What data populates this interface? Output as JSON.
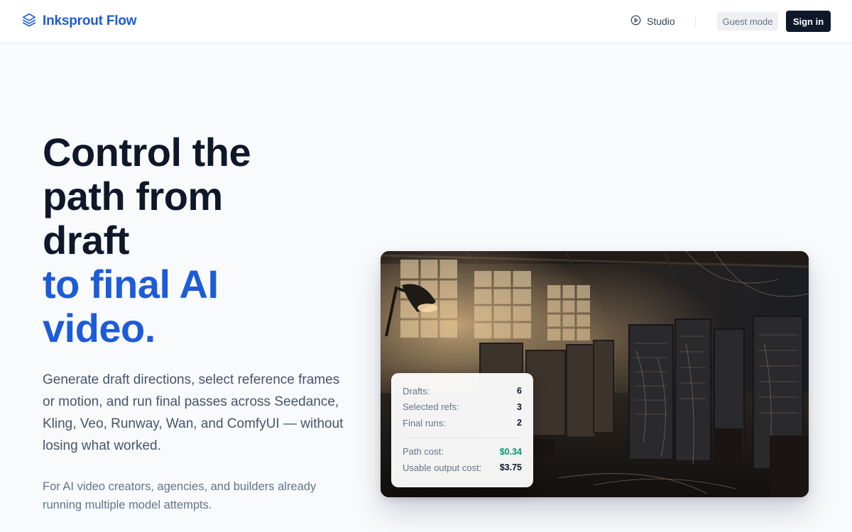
{
  "header": {
    "brand_name": "Inksprout Flow",
    "brand_icon": "layers-icon",
    "studio_label": "Studio",
    "studio_icon": "play-circle-icon",
    "guest_label": "Guest mode",
    "signin_label": "Sign in"
  },
  "hero": {
    "title_line1": "Control the",
    "title_line2": "path from",
    "title_line3": "draft",
    "title_accent_line1": "to final AI",
    "title_accent_line2": "video.",
    "description": "Generate draft directions, select reference frames or motion, and run final passes across Seedance, Kling, Veo, Runway, Wan, and ComfyUI — without losing what worked.",
    "subtext": "For AI video creators, agencies, and builders already running multiple model attempts."
  },
  "stats": {
    "drafts_label": "Drafts:",
    "drafts_value": "6",
    "refs_label": "Selected refs:",
    "refs_value": "3",
    "runs_label": "Final runs:",
    "runs_value": "2",
    "path_cost_label": "Path cost:",
    "path_cost_value": "$0.34",
    "usable_cost_label": "Usable output cost:",
    "usable_cost_value": "$3.75"
  },
  "colors": {
    "accent": "#1d5bd8",
    "dark": "#0f172a",
    "green": "#059669",
    "background": "#f8fafc"
  }
}
